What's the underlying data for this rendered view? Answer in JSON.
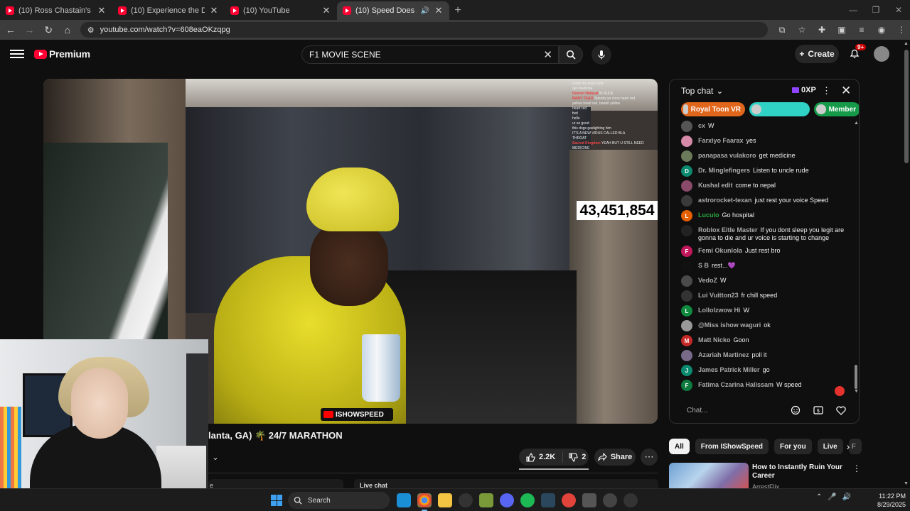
{
  "browser": {
    "tabs": [
      {
        "title": "(10) Ross Chastain's video gam"
      },
      {
        "title": "(10) Experience the Disaster th"
      },
      {
        "title": "(10) YouTube"
      },
      {
        "title": "(10) Speed Does America u"
      }
    ],
    "url": "youtube.com/watch?v=608eaOKzqpg"
  },
  "youtube": {
    "logo_text": "Premium",
    "search_value": "F1 MOVIE SCENE",
    "create_label": "Create",
    "notification_badge": "9+"
  },
  "video": {
    "view_counter": "43,451,854",
    "watermark": "ISHOWSPEED",
    "overlay_chat": [
      {
        "user": "",
        "text": "Listen to uncle rude"
      },
      {
        "user": "",
        "text": "get medicine"
      },
      {
        "user": "Donnel Hidayat",
        "text": "W RUDE"
      },
      {
        "user": "BABY TSAO",
        "text": "Speedy yo cooo heart red"
      },
      {
        "user": "",
        "text": "yellow heart red, bandit yellow"
      },
      {
        "user": "",
        "text": "heart red"
      },
      {
        "user": "",
        "text": "fwd"
      },
      {
        "user": "",
        "text": "hello"
      },
      {
        "user": "",
        "text": "ur so good"
      },
      {
        "user": "",
        "text": "this dogs gaslighting him"
      },
      {
        "user": "",
        "text": "IT'S A NEW VIRUS CALLED BLA"
      },
      {
        "user": "",
        "text": "THROAT"
      },
      {
        "user": "Sacred Kingdom",
        "text": "YEAH BUT U STILL NEED"
      },
      {
        "user": "",
        "text": "MEDICINE"
      }
    ]
  },
  "below_video": {
    "title_fragment": "lanta, GA) 🌴 24/7 MARATHON",
    "likes": "2.2K",
    "dislikes": "2",
    "share_label": "Share",
    "peek_left": "e",
    "peek_right": "Live chat"
  },
  "chat": {
    "mode_label": "Top chat",
    "xp_label": "0XP",
    "pinned": [
      {
        "label": "Royal Toon VR",
        "color": "#e0661c"
      },
      {
        "label": "",
        "color": "#2fd2c4"
      },
      {
        "label": "Member",
        "color": "#159a4a"
      }
    ],
    "messages": [
      {
        "user": "cx",
        "text": "W",
        "avatar": "",
        "color": "#555555",
        "user_color": "grey"
      },
      {
        "user": "Farxiyo Faarax",
        "text": "yes",
        "avatar": "",
        "color": "#d68aa8",
        "user_color": "grey"
      },
      {
        "user": "panapasa vulakoro",
        "text": "get medicine",
        "avatar": "",
        "color": "#6a7a5a",
        "user_color": "grey"
      },
      {
        "user": "Dr. Minglefingers",
        "text": "Listen to uncle rude",
        "avatar": "D",
        "color": "#0b8a6f",
        "user_color": "grey"
      },
      {
        "user": "Kushal edit",
        "text": "come to nepal",
        "avatar": "",
        "color": "#8a4a6a",
        "user_color": "grey"
      },
      {
        "user": "astrorocket-texan",
        "text": "just rest your voice Speed",
        "avatar": "",
        "color": "#3a3a3a",
        "user_color": "grey"
      },
      {
        "user": "Luculo",
        "text": "Go hospital",
        "avatar": "L",
        "color": "#e65f00",
        "user_color": "green"
      },
      {
        "user": "Roblox Eitle Master",
        "text": "If you dont sleep you legit are gonna to die and ur voice is starting to change",
        "avatar": "",
        "color": "#222222",
        "user_color": "grey"
      },
      {
        "user": "Femi Okunlola",
        "text": "Just rest bro",
        "avatar": "F",
        "color": "#c2185b",
        "user_color": "grey"
      },
      {
        "user": "S B",
        "text": "rest...💜",
        "avatar": "",
        "color": "#111111",
        "user_color": "grey"
      },
      {
        "user": "VedoZ",
        "text": "W",
        "avatar": "",
        "color": "#4a4a4a",
        "user_color": "grey"
      },
      {
        "user": "Lui Vuitton23",
        "text": "fr chill speed",
        "avatar": "",
        "color": "#333333",
        "user_color": "grey"
      },
      {
        "user": "Lollolzwow Hi",
        "text": "W",
        "avatar": "L",
        "color": "#0f8a3e",
        "user_color": "grey"
      },
      {
        "user": "@Miss ishow waguri",
        "text": "ok",
        "avatar": "",
        "color": "#999999",
        "user_color": "grey"
      },
      {
        "user": "Matt Nicko",
        "text": "Goon",
        "avatar": "M",
        "color": "#c62828",
        "user_color": "grey"
      },
      {
        "user": "Azariah Martinez",
        "text": "poll it",
        "avatar": "",
        "color": "#7a6a8a",
        "user_color": "grey"
      },
      {
        "user": "James Patrick Miller",
        "text": "go",
        "avatar": "J",
        "color": "#0b8a6f",
        "user_color": "grey"
      },
      {
        "user": "Fatima Czarina Halissam",
        "text": "W speed",
        "avatar": "F",
        "color": "#0f7a3e",
        "user_color": "grey"
      }
    ],
    "input_placeholder": "Chat..."
  },
  "chips": [
    "All",
    "From IShowSpeed",
    "For you",
    "Live",
    "F"
  ],
  "recommendation": {
    "title": "How to Instantly Ruin Your Career",
    "channel": "ArrestFlix"
  },
  "taskbar": {
    "search_label": "Search",
    "time": "11:22 PM",
    "date": "8/29/2025"
  }
}
